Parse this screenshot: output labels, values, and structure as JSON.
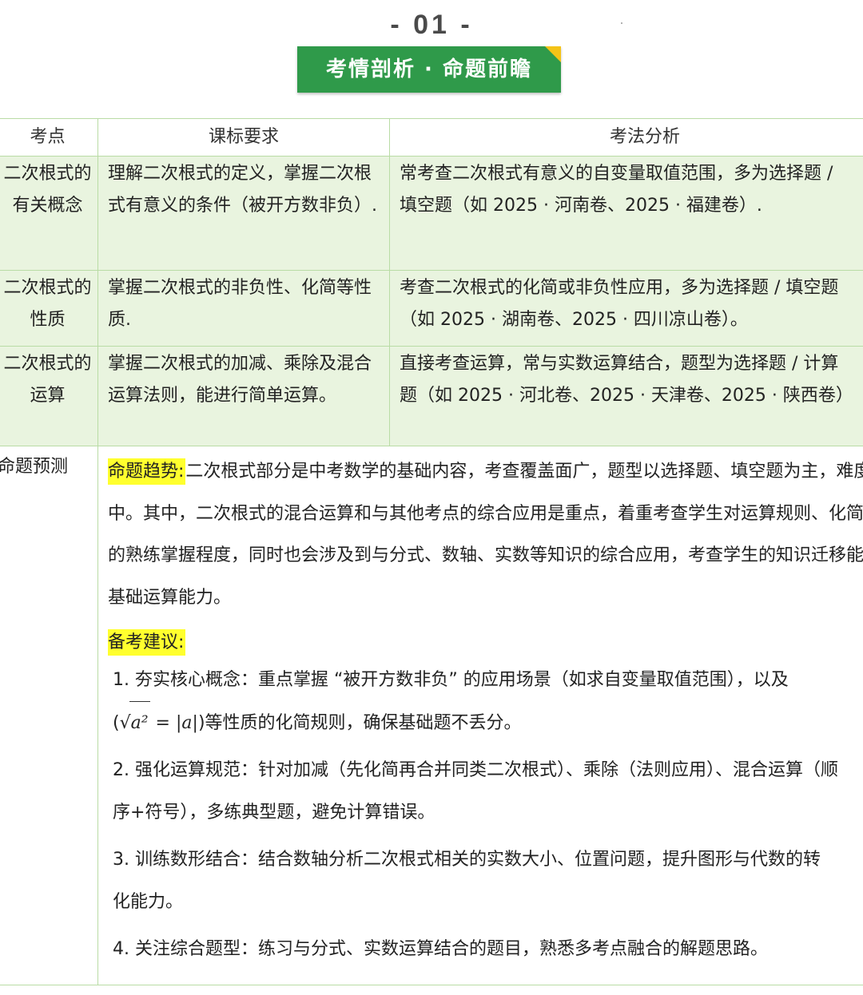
{
  "header": {
    "section_number": "- 01 -",
    "banner": "考情剖析 · 命题前瞻"
  },
  "table": {
    "columns": [
      "考点",
      "课标要求",
      "考法分析"
    ],
    "rows": [
      {
        "point": [
          "二次根式的",
          "有关概念"
        ],
        "requirement": "理解二次根式的定义，掌握二次根式有意义的条件（被开方数非负）.",
        "analysis": [
          "常考查二次根式有意义的自变量取值范围，多为选择题 / ",
          "填空题（如 2025 · 河南卷、2025 · 福建卷）."
        ]
      },
      {
        "point": [
          "二次根式的",
          "性质"
        ],
        "requirement": "掌握二次根式的非负性、化简等性质.",
        "analysis": [
          "考查二次根式的化简或非负性应用，多为选择题 / 填空题",
          "（如 2025 · 湖南卷、2025 · 四川凉山卷）。"
        ]
      },
      {
        "point": [
          "二次根式的",
          "运算"
        ],
        "requirement": "掌握二次根式的加减、乘除及混合运算法则，能进行简单运算。",
        "analysis": [
          "直接考查运算，常与实数运算结合，题型为选择题 / 计算",
          "题（如 2025 · 河北卷、2025 · 天津卷、2025 · 陕西卷）"
        ]
      }
    ],
    "forecast": {
      "label": "命题预测",
      "trend_title": "命题趋势:",
      "trend_text": "二次根式部分是中考数学的基础内容，考查覆盖面广，题型以选择题、填空题为主，难度适中。其中，二次根式的混合运算和与其他考点的综合应用是重点，着重考查学生对运算规则、化简方法的熟练掌握程度，同时也会涉及到与分式、数轴、实数等知识的综合应用，考查学生的知识迁移能力和基础运算能力。",
      "advice_title": "备考建议:",
      "items": [
        {
          "line1": "1. 夯实核心概念：重点掌握 “被开方数非负” 的应用场景（如求自变量取值范围），以及",
          "formula_prefix": "(",
          "formula_radicand": "a²",
          "formula_eq": " = |a|",
          "formula_suffix": ")等性质的化简规则，确保基础题不丢分。"
        },
        {
          "line1": "2. 强化运算规范：针对加减（先化简再合并同类二次根式）、乘除（法则应用）、混合运算（顺",
          "line2": "序+符号），多练典型题，避免计算错误。"
        },
        {
          "line1": "3. 训练数形结合：结合数轴分析二次根式相关的实数大小、位置问题，提升图形与代数的转",
          "line2": "化能力。"
        },
        {
          "line1": "4. 关注综合题型：练习与分式、实数运算结合的题目，熟悉多考点融合的解题思路。"
        }
      ]
    }
  },
  "colors": {
    "banner_green": "#2f9a4a",
    "corner_yellow": "#f4c317",
    "row_green": "#e9f4df",
    "border_green": "#b9dca5",
    "highlight_yellow": "#ffff2e"
  }
}
